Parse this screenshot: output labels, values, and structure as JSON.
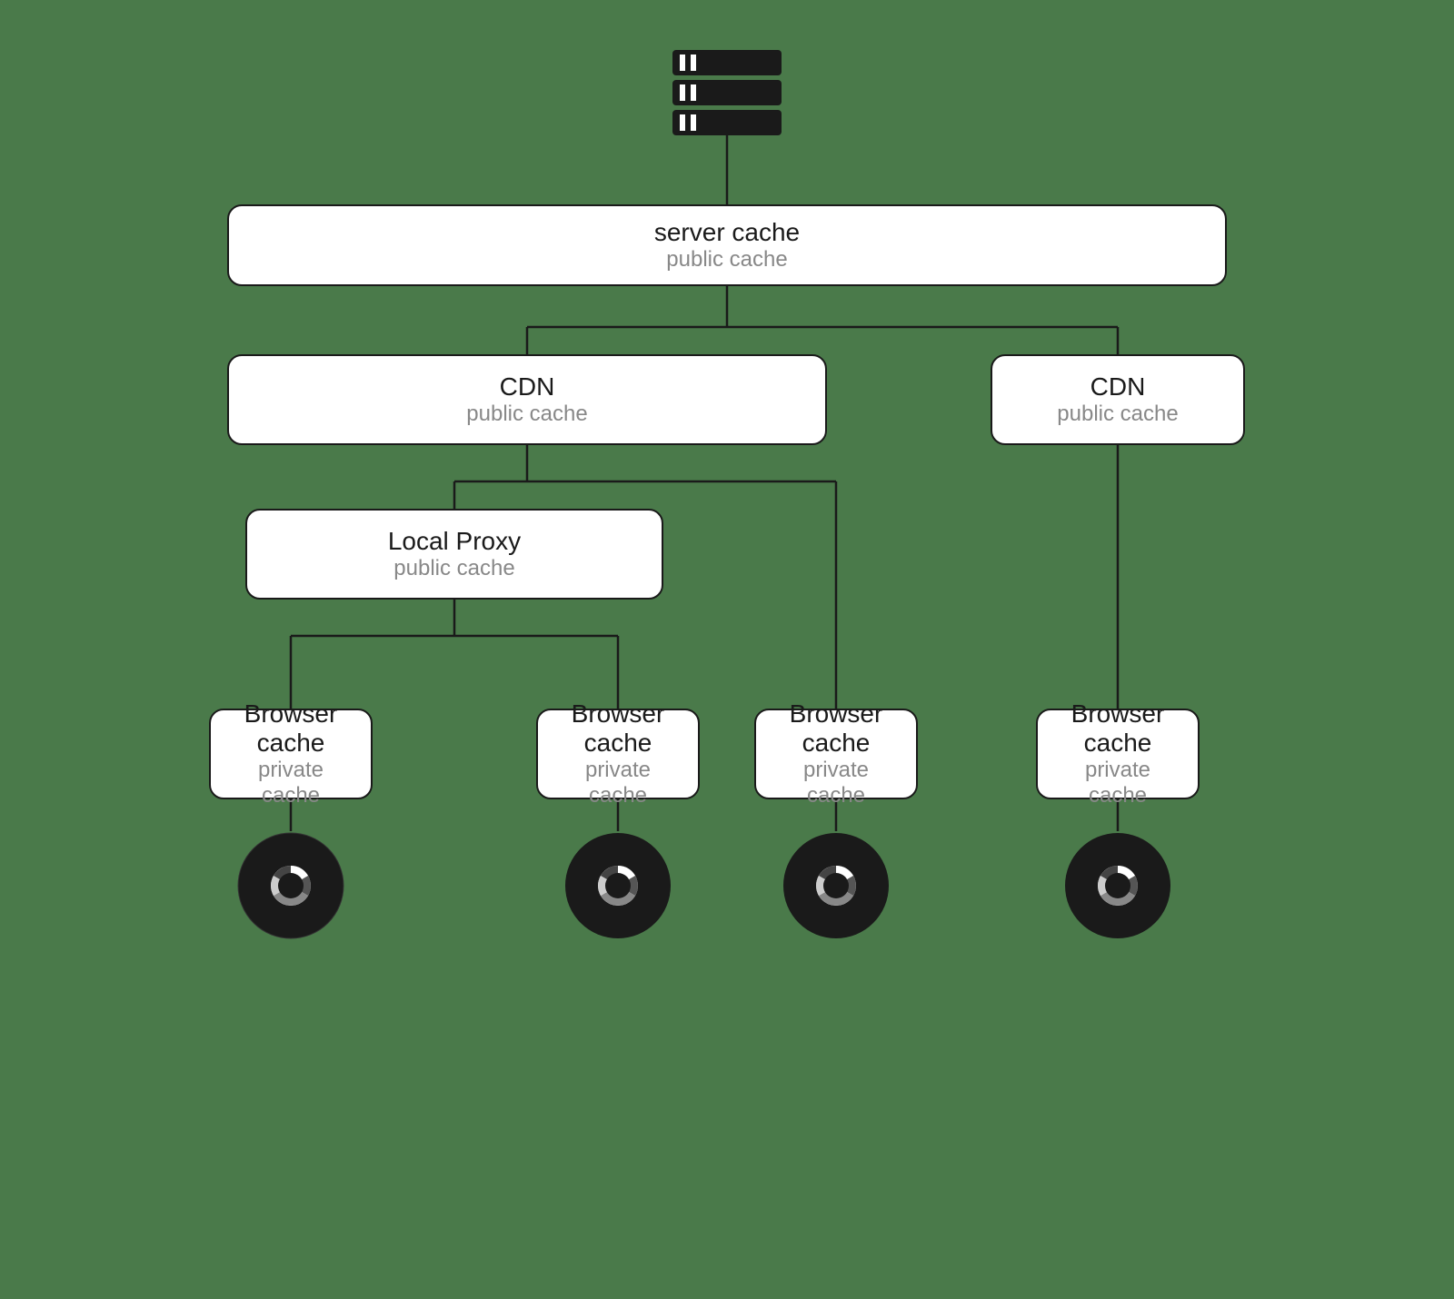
{
  "diagram": {
    "background": "#4a7a4a",
    "nodes": {
      "server": {
        "label": "server cache",
        "sublabel": "public cache"
      },
      "cdn_left": {
        "label": "CDN",
        "sublabel": "public cache"
      },
      "cdn_right": {
        "label": "CDN",
        "sublabel": "public cache"
      },
      "local_proxy": {
        "label": "Local Proxy",
        "sublabel": "public cache"
      },
      "browser1": {
        "label": "Browser cache",
        "sublabel": "private cache"
      },
      "browser2": {
        "label": "Browser cache",
        "sublabel": "private cache"
      },
      "browser3": {
        "label": "Browser cache",
        "sublabel": "private cache"
      },
      "browser4": {
        "label": "Browser cache",
        "sublabel": "private cache"
      }
    }
  }
}
